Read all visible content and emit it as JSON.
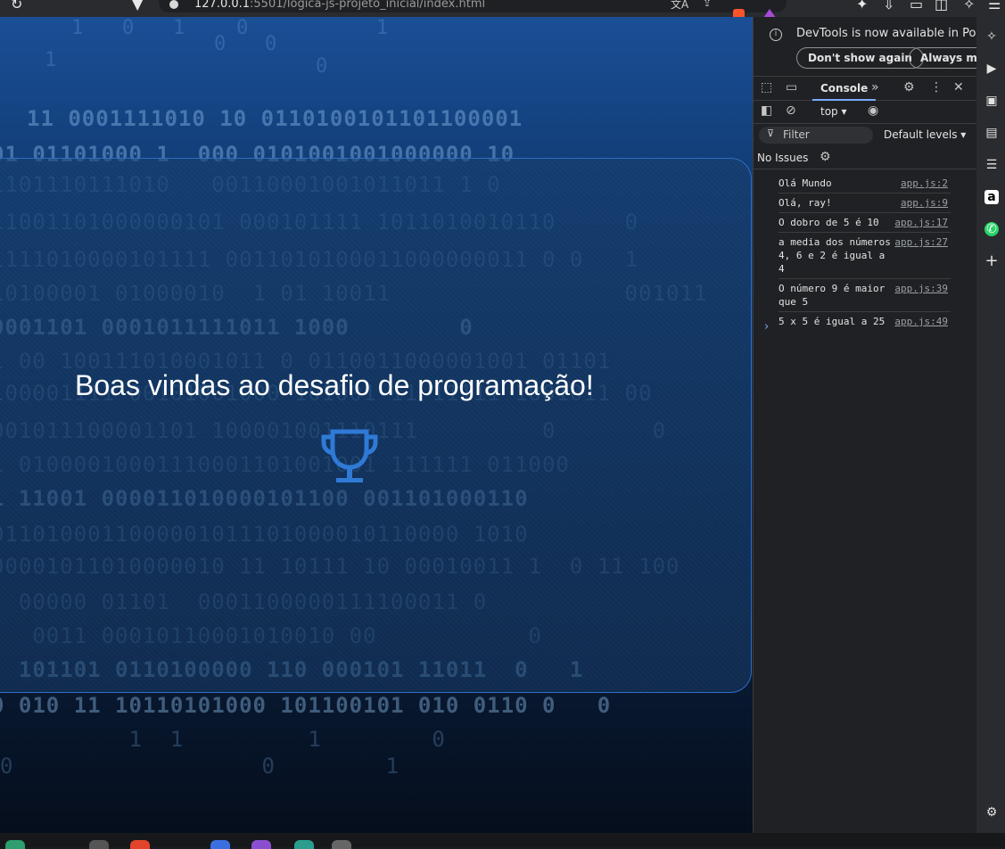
{
  "browser": {
    "url_host": "127.0.0.1",
    "url_rest": ":5501/logica-js-projeto_inicial/index.html"
  },
  "page": {
    "title": "Boas vindas ao desafio de programação!",
    "icon": "trophy-icon",
    "accent_color": "#2f7ad6"
  },
  "devtools": {
    "notice": "DevTools is now available in Portug",
    "dont_show_label": "Don't show again",
    "always_match_label": "Always matc",
    "tab_console": "Console",
    "context": "top ▾",
    "filter_placeholder": "Filter",
    "levels": "Default levels ▾",
    "issues": "No Issues",
    "logs": [
      {
        "text": "Olá Mundo",
        "source": "app.js:2"
      },
      {
        "text": "Olá, ray!",
        "source": "app.js:9"
      },
      {
        "text": "O dobro de 5 é 10",
        "source": "app.js:17"
      },
      {
        "text": "a media dos números 4, 6 e 2 é igual a 4",
        "source": "app.js:27"
      },
      {
        "text": "O número  9 é maior que 5",
        "source": "app.js:39"
      },
      {
        "text": "5 x 5 é igual a 25",
        "source": "app.js:49"
      }
    ],
    "prompt": "›"
  }
}
